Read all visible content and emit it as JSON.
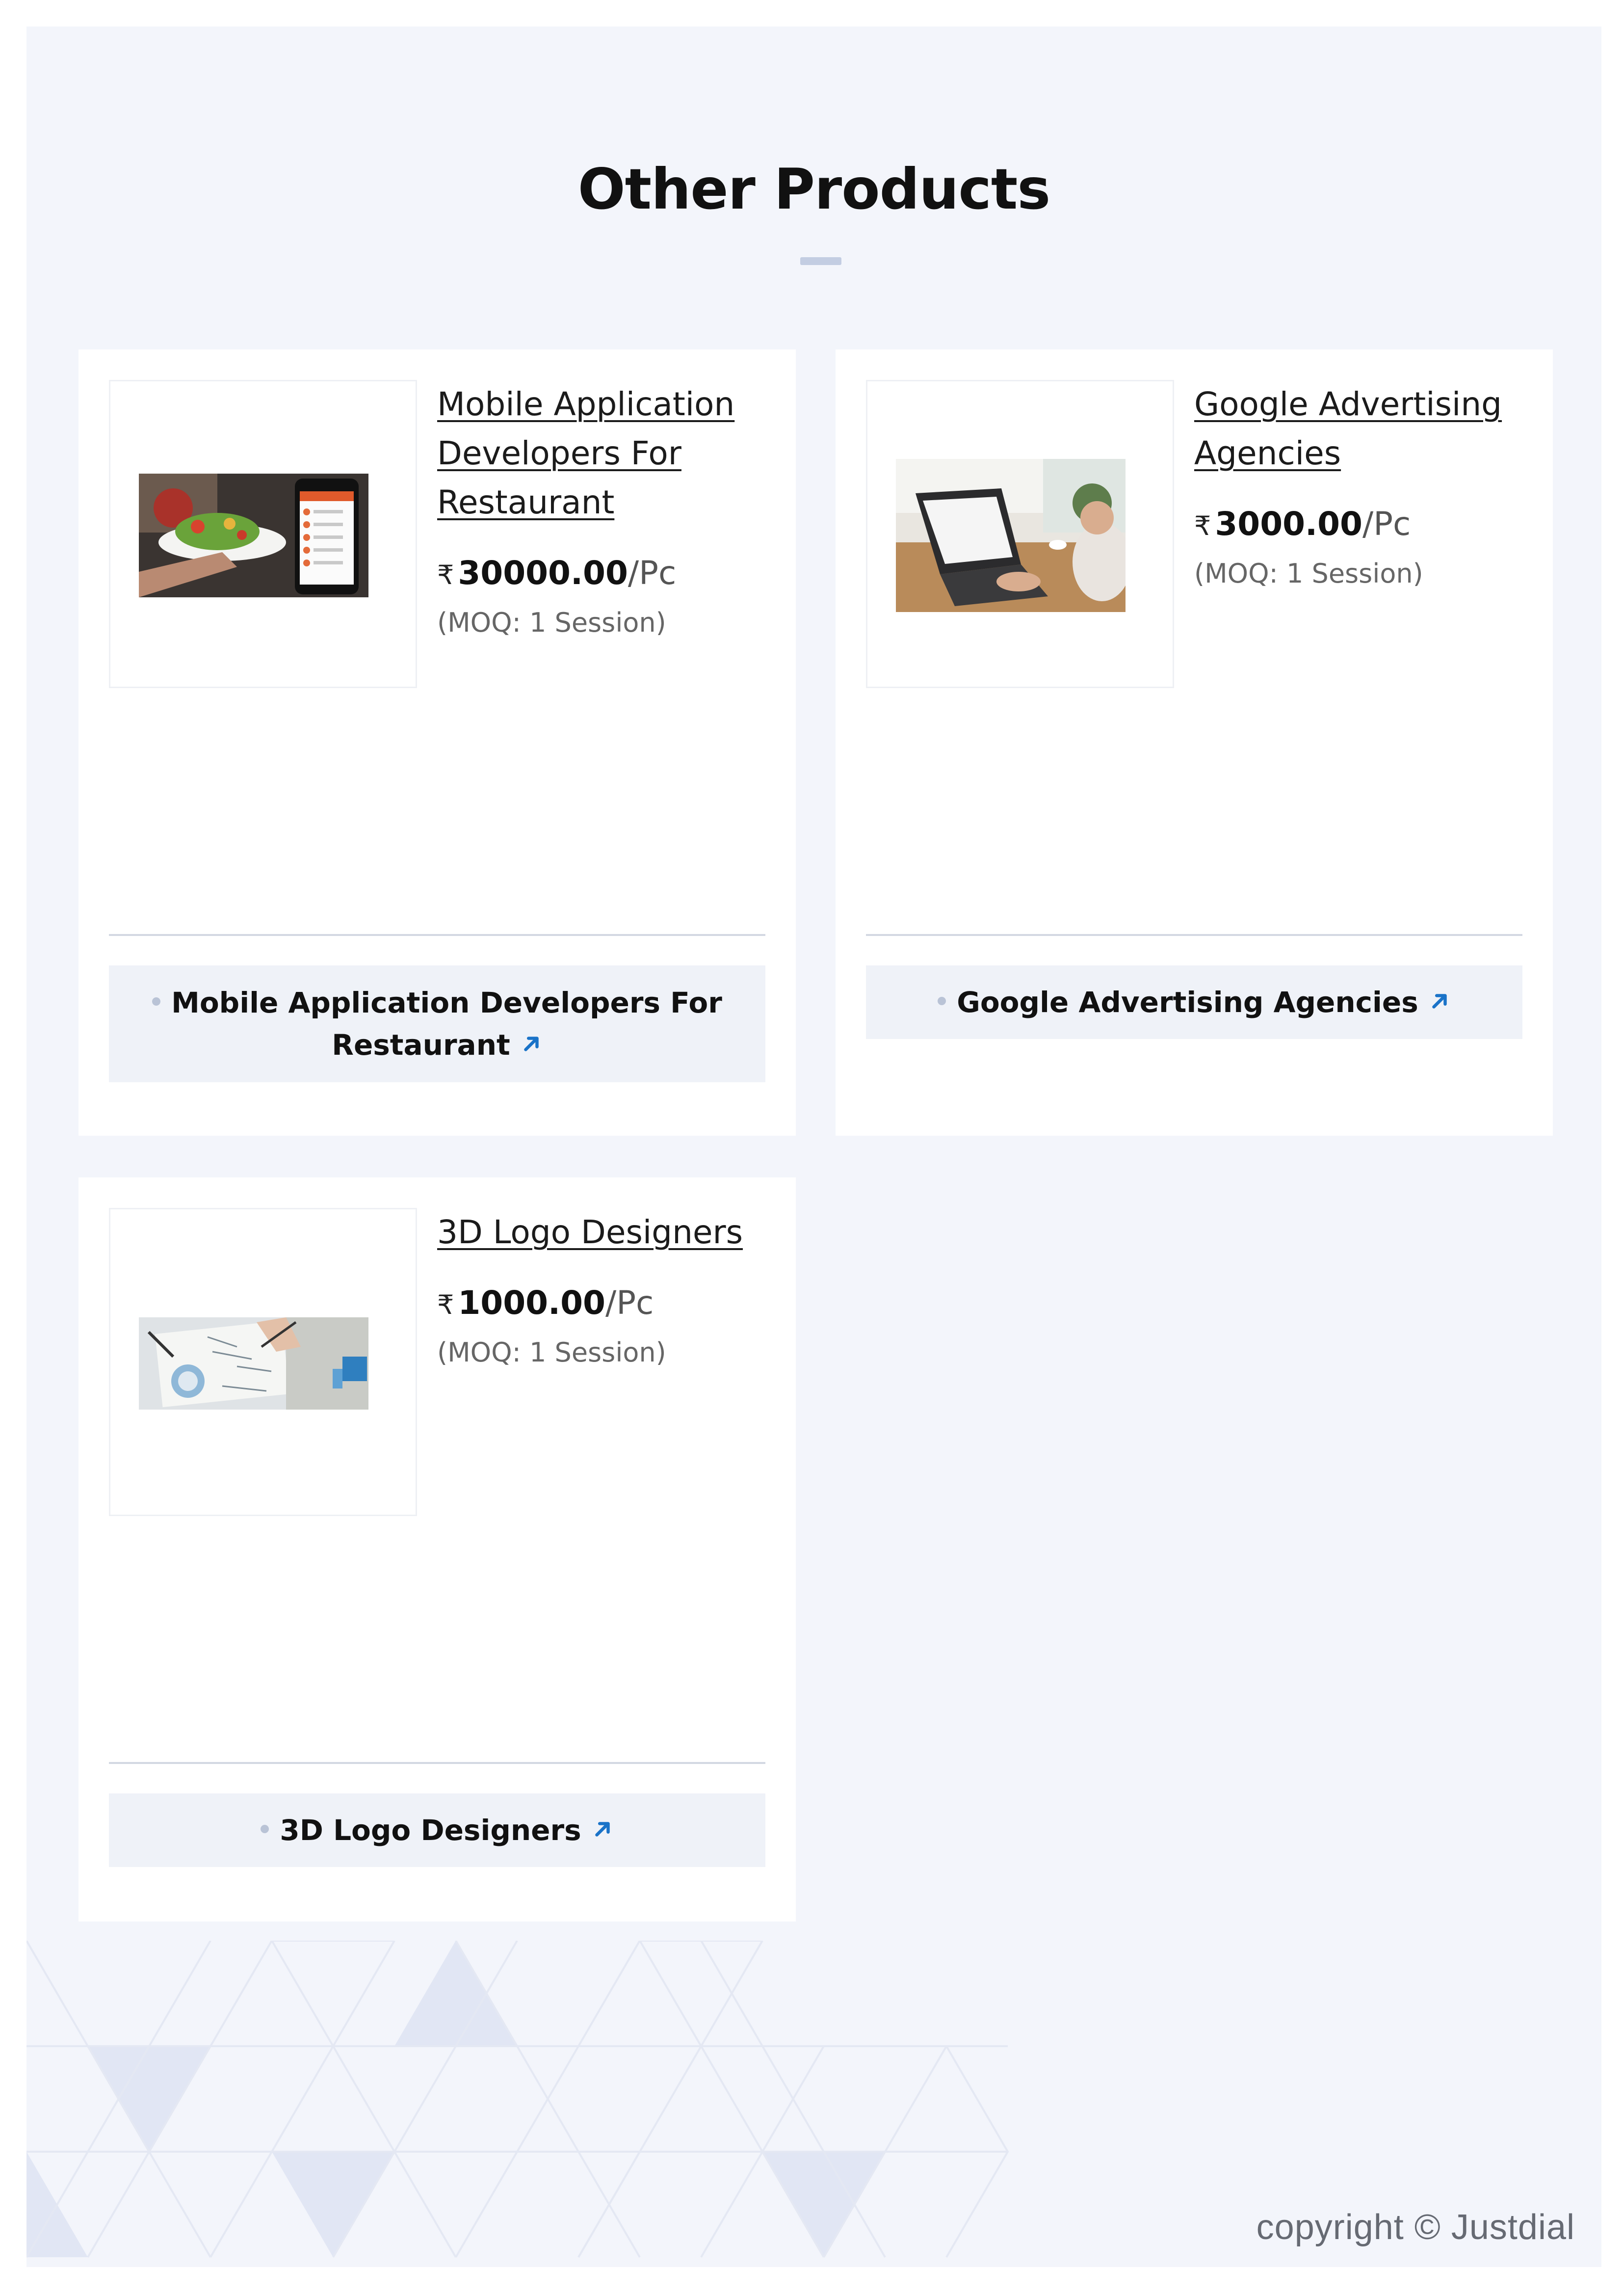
{
  "section": {
    "title": "Other Products"
  },
  "products": [
    {
      "name": "Mobile Application Developers For Restaurant",
      "currency": "₹",
      "price": "30000.00",
      "unit": "/Pc",
      "moq": "(MOQ: 1 Session)",
      "tag_label": "Mobile Application Developers For Restaurant",
      "image_icon": "food-app-photo"
    },
    {
      "name": "Google Advertising Agencies",
      "currency": "₹",
      "price": "3000.00",
      "unit": "/Pc",
      "moq": "(MOQ: 1 Session)",
      "tag_label": "Google Advertising Agencies",
      "image_icon": "laptop-photo"
    },
    {
      "name": "3D Logo Designers",
      "currency": "₹",
      "price": "1000.00",
      "unit": "/Pc",
      "moq": "(MOQ: 1 Session)",
      "tag_label": "3D Logo Designers",
      "image_icon": "design-sketch-photo"
    }
  ],
  "footer": {
    "copyright": "copyright © Justdial"
  },
  "colors": {
    "accent": "#1a73c8",
    "page_bg": "#f3f5fb",
    "tag_bg": "#eff2f8"
  }
}
